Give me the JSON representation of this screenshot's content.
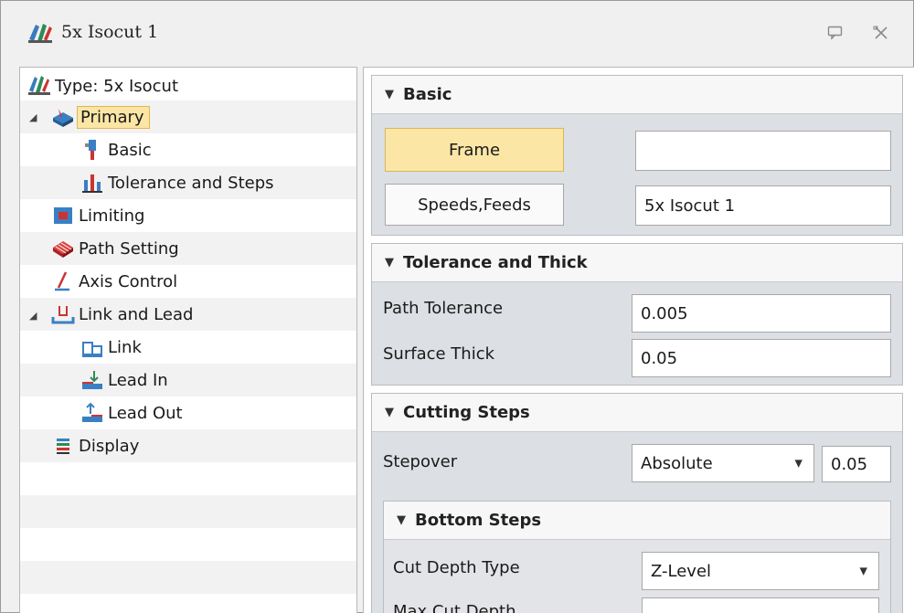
{
  "window": {
    "title": "5x Isocut 1",
    "pin_icon": "pin-icon",
    "close_icon": "close-icon"
  },
  "tree": {
    "items": [
      {
        "label": "Type: 5x Isocut",
        "icon": "operation-type-icon"
      },
      {
        "label": "Primary",
        "icon": "primary-icon",
        "expanded": true,
        "selected": true
      },
      {
        "label": "Basic",
        "icon": "tool-icon"
      },
      {
        "label": "Tolerance and Steps",
        "icon": "tolerance-icon"
      },
      {
        "label": "Limiting",
        "icon": "limiting-icon"
      },
      {
        "label": "Path Setting",
        "icon": "path-setting-icon"
      },
      {
        "label": "Axis Control",
        "icon": "axis-control-icon"
      },
      {
        "label": "Link and Lead",
        "icon": "link-lead-icon",
        "expanded": true
      },
      {
        "label": "Link",
        "icon": "link-icon"
      },
      {
        "label": "Lead In",
        "icon": "lead-in-icon"
      },
      {
        "label": "Lead Out",
        "icon": "lead-out-icon"
      },
      {
        "label": "Display",
        "icon": "display-icon"
      }
    ]
  },
  "basic": {
    "header": "Basic",
    "frame_label": "Frame",
    "frame_value": "",
    "speeds_label": "Speeds,Feeds",
    "speeds_value": "5x Isocut 1"
  },
  "tolerance": {
    "header": "Tolerance and Thick",
    "path_tolerance_label": "Path Tolerance",
    "path_tolerance_value": "0.005",
    "surface_thick_label": "Surface Thick",
    "surface_thick_value": "0.05"
  },
  "cutting_steps": {
    "header": "Cutting Steps",
    "stepover_label": "Stepover",
    "stepover_mode": "Absolute",
    "stepover_value": "0.05"
  },
  "bottom_steps": {
    "header": "Bottom Steps",
    "cut_depth_type_label": "Cut Depth Type",
    "cut_depth_type_value": "Z-Level",
    "max_cut_depth_label": "Max Cut Depth",
    "max_cut_depth_value": ""
  },
  "colors": {
    "selected_bg": "#fbe6a6",
    "group_bg": "#dcdfe3"
  }
}
